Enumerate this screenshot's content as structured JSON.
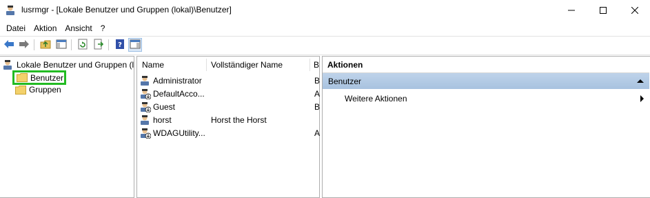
{
  "window": {
    "title": "lusrmgr - [Lokale Benutzer und Gruppen (lokal)\\Benutzer]"
  },
  "menu": {
    "items": [
      "Datei",
      "Aktion",
      "Ansicht",
      "?"
    ]
  },
  "toolbar": {
    "buttons": [
      "back-icon",
      "forward-icon",
      "up-folder-icon",
      "show-hide-tree-icon",
      "refresh-icon",
      "export-list-icon",
      "help-icon",
      "show-hide-action-pane-icon"
    ]
  },
  "tree": {
    "root_label": "Lokale Benutzer und Gruppen (lokal)",
    "items": [
      {
        "label": "Benutzer",
        "selected": true
      },
      {
        "label": "Gruppen",
        "selected": false
      }
    ]
  },
  "list": {
    "columns": [
      "Name",
      "Vollständiger Name",
      "Beschreibung"
    ],
    "rows": [
      {
        "name": "Administrator",
        "full_name": "",
        "description": "B",
        "disabled": false
      },
      {
        "name": "DefaultAcco...",
        "full_name": "",
        "description": "A",
        "disabled": true
      },
      {
        "name": "Guest",
        "full_name": "",
        "description": "B",
        "disabled": true
      },
      {
        "name": "horst",
        "full_name": "Horst the Horst",
        "description": "",
        "disabled": false
      },
      {
        "name": "WDAGUtility...",
        "full_name": "",
        "description": "A",
        "disabled": true
      }
    ]
  },
  "actions": {
    "title": "Aktionen",
    "group_label": "Benutzer",
    "items": [
      "Weitere Aktionen"
    ]
  },
  "colors": {
    "selection_highlight": "#22bb22",
    "actions_group_bg": "#b5cbe5"
  }
}
